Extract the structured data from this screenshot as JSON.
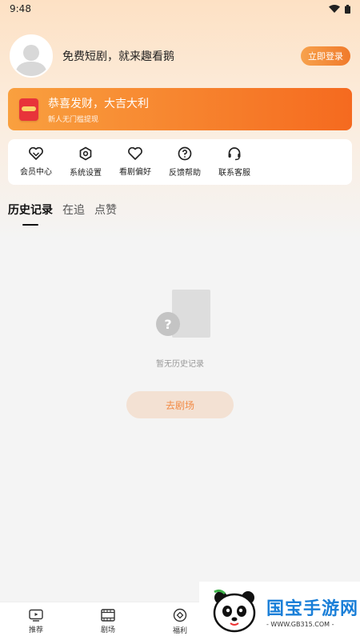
{
  "status": {
    "time": "9:48"
  },
  "profile": {
    "greeting": "免费短剧，就来趣看鹅",
    "login_label": "立即登录"
  },
  "banner": {
    "title": "恭喜发财，大吉大利",
    "subtitle": "新人无门槛提现"
  },
  "menu": [
    {
      "label": "会员中心",
      "icon": "vip-heart-icon"
    },
    {
      "label": "系统设置",
      "icon": "settings-icon"
    },
    {
      "label": "看剧偏好",
      "icon": "heart-icon"
    },
    {
      "label": "反馈帮助",
      "icon": "help-icon"
    },
    {
      "label": "联系客服",
      "icon": "headset-icon"
    }
  ],
  "tabs": [
    {
      "label": "历史记录",
      "active": true
    },
    {
      "label": "在追",
      "active": false
    },
    {
      "label": "点赞",
      "active": false
    }
  ],
  "empty": {
    "message": "暂无历史记录",
    "button_label": "去剧场",
    "glyph": "?"
  },
  "bottom_nav": [
    {
      "label": "推荐",
      "icon": "tv-icon"
    },
    {
      "label": "剧场",
      "icon": "film-icon"
    },
    {
      "label": "福利",
      "icon": "gift-icon"
    }
  ],
  "watermark": {
    "brand": "国宝手游网",
    "url": "- WWW.GB315.COM -"
  },
  "colors": {
    "accent": "#f07a2b",
    "banner_start": "#f9a03f",
    "banner_end": "#f56a1f",
    "watermark_blue": "#1a7fd8"
  }
}
